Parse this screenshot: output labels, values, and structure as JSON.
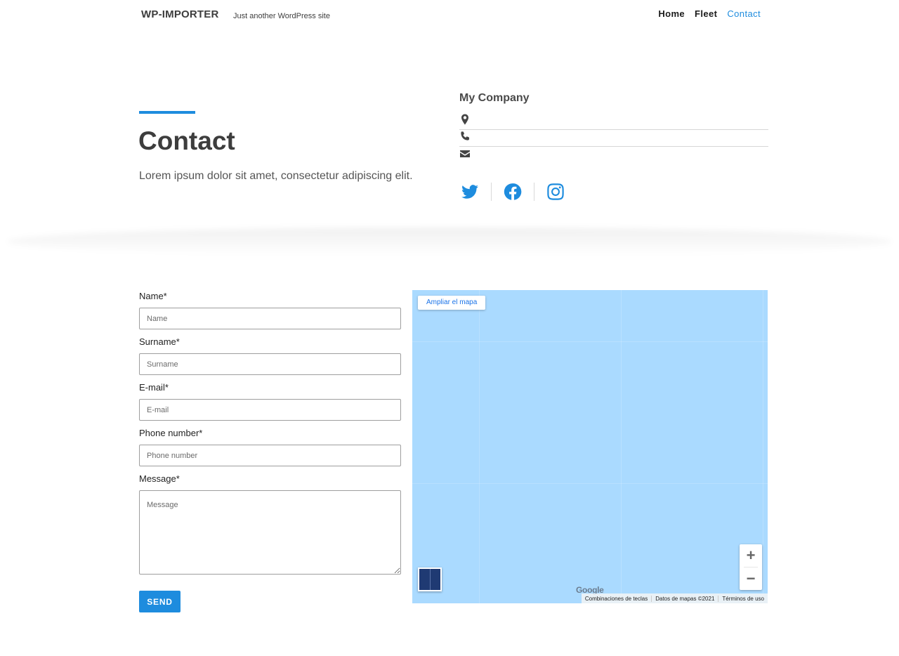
{
  "header": {
    "site_title": "WP-IMPORTER",
    "tagline": "Just another WordPress site",
    "nav": [
      {
        "label": "Home",
        "active": false
      },
      {
        "label": "Fleet",
        "active": false
      },
      {
        "label": "Contact",
        "active": true
      }
    ]
  },
  "hero": {
    "title": "Contact",
    "lead": "Lorem ipsum dolor sit amet, consectetur adipiscing elit.",
    "company_name": "My Company",
    "info_icons": [
      "map-marker-icon",
      "phone-icon",
      "envelope-icon"
    ],
    "socials": [
      "twitter-icon",
      "facebook-icon",
      "instagram-icon"
    ]
  },
  "form": {
    "name_label": "Name*",
    "name_placeholder": "Name",
    "surname_label": "Surname*",
    "surname_placeholder": "Surname",
    "email_label": "E-mail*",
    "email_placeholder": "E-mail",
    "phone_label": "Phone number*",
    "phone_placeholder": "Phone number",
    "message_label": "Message*",
    "message_placeholder": "Message",
    "send_label": "SEND"
  },
  "map": {
    "enlarge_label": "Ampliar el mapa",
    "zoom_in": "+",
    "zoom_out": "−",
    "logo": "Google",
    "attribution": [
      "Combinaciones de teclas",
      "Datos de mapas ©2021",
      "Términos de uso"
    ]
  },
  "colors": {
    "accent": "#1e8cde",
    "map_water": "#aadaff"
  }
}
